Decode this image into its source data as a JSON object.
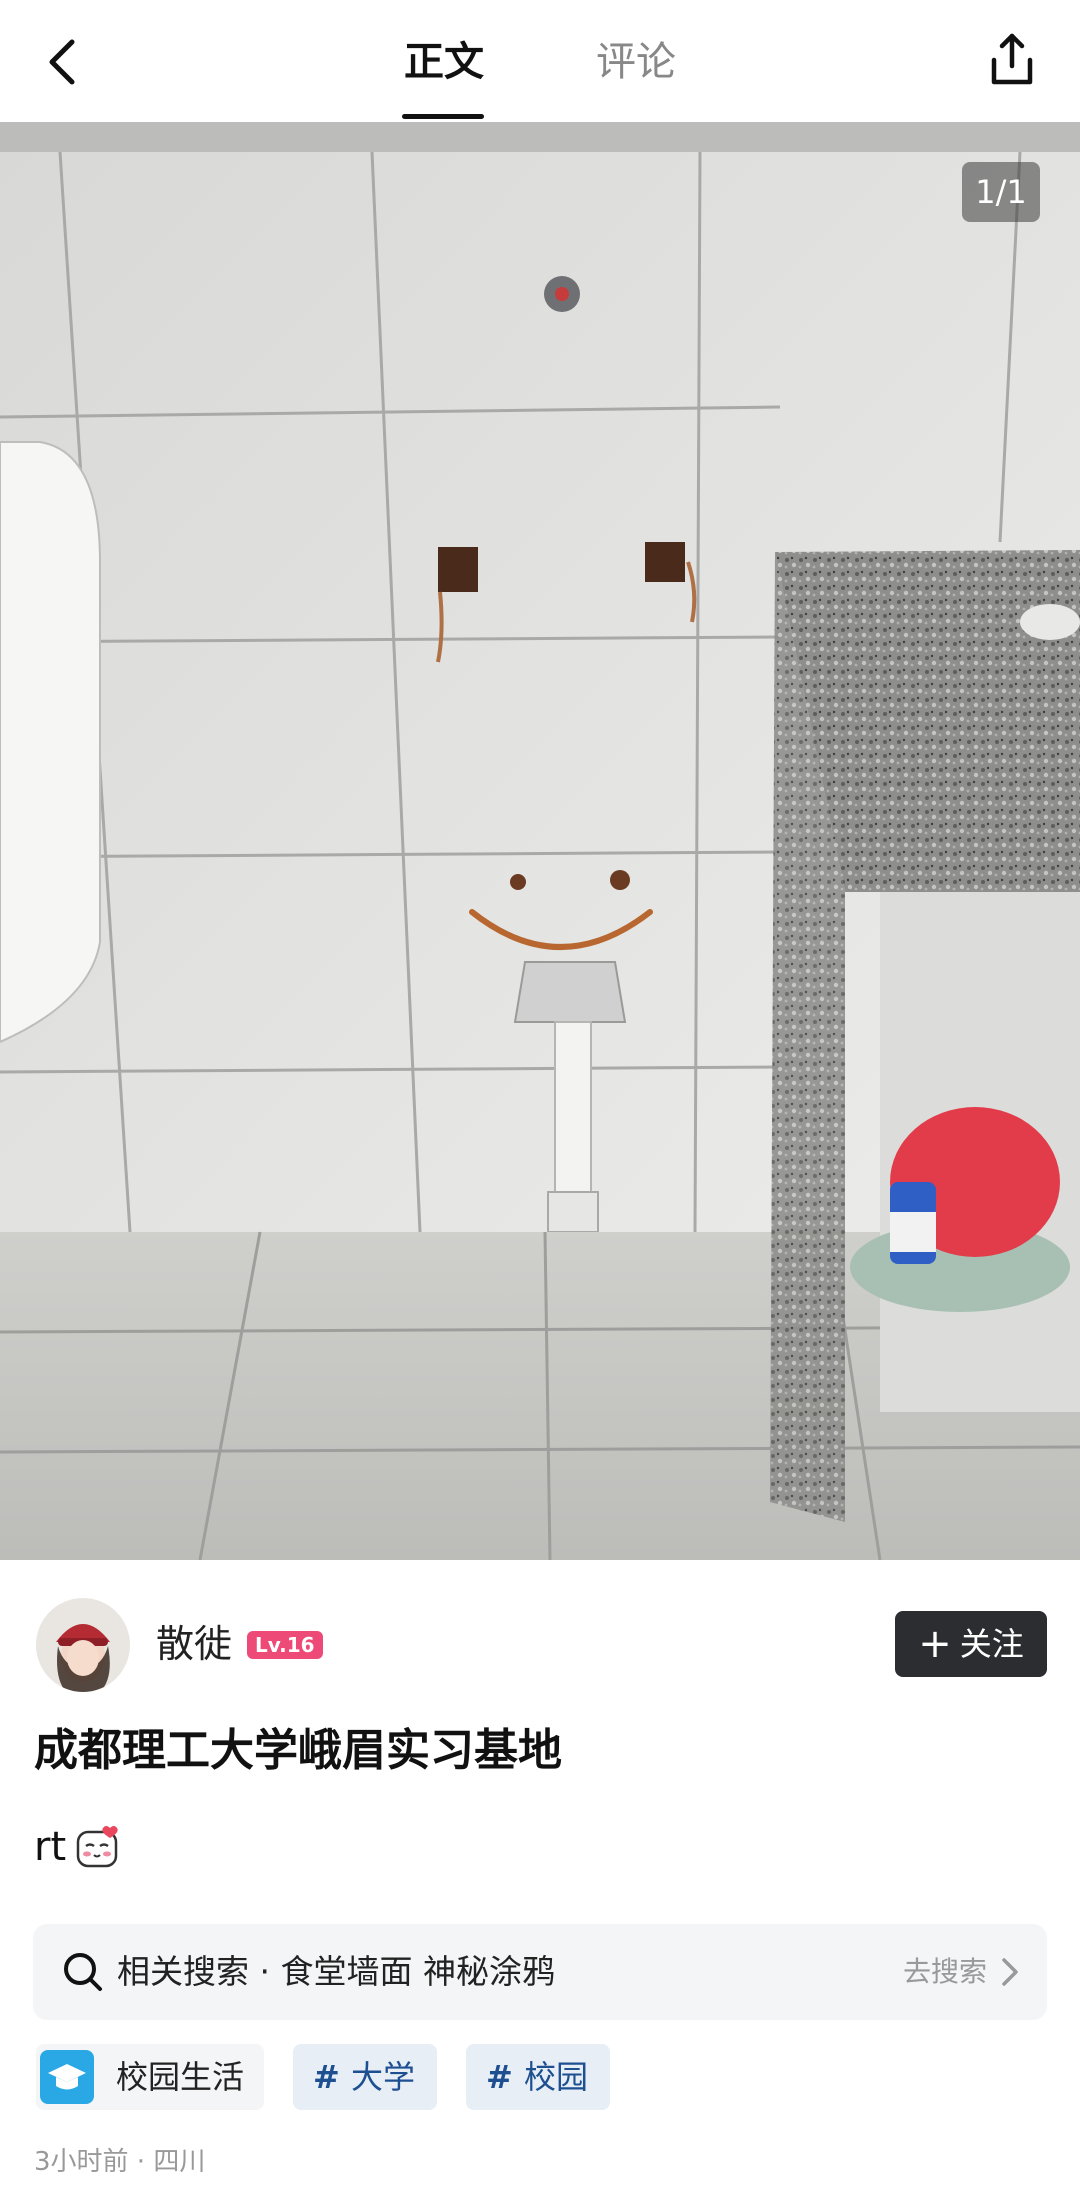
{
  "tabs": {
    "main": "正文",
    "comments": "评论"
  },
  "image_counter": "1/1",
  "author": {
    "name": "散徙",
    "level": "Lv.16",
    "follow_label": "关注"
  },
  "post": {
    "title": "成都理工大学峨眉实习基地",
    "body": "rt"
  },
  "related_search": {
    "label": "相关搜索 · 食堂墙面 神秘涂鸦",
    "action": "去搜索"
  },
  "tags": {
    "campus": "校园生活",
    "tag1": "大学",
    "tag2": "校园",
    "hash": "#"
  },
  "meta": "3小时前 · 四川",
  "icons": {
    "back": "back-arrow-icon",
    "share": "share-icon",
    "search": "search-icon",
    "chevron": "chevron-right-icon",
    "campus": "graduation-cap-icon"
  },
  "colors": {
    "level_badge": "#ee4a78",
    "follow_button": "#2b2d31",
    "tag_text": "#1d4f91",
    "campus_icon": "#2aa8e6"
  }
}
